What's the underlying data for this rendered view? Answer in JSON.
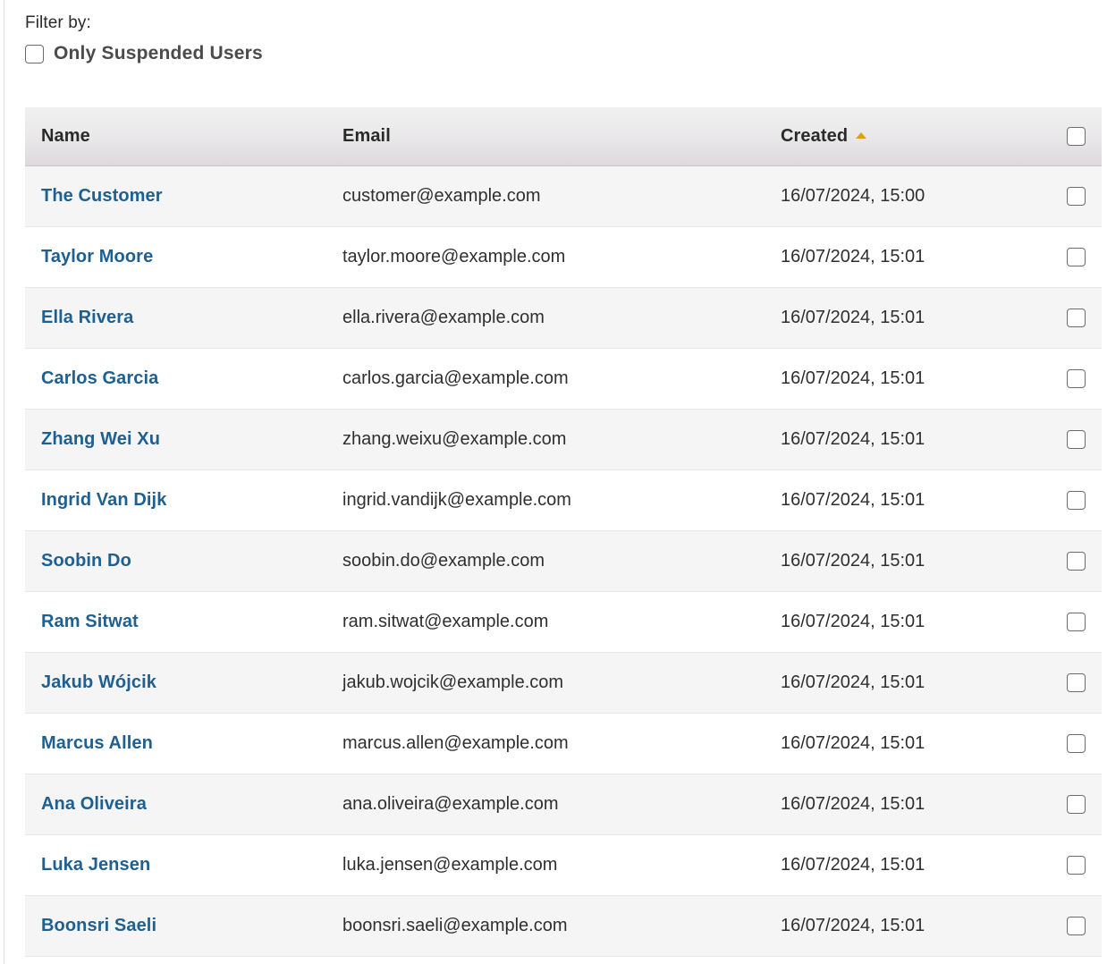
{
  "filter": {
    "label": "Filter by:",
    "suspended_checkbox_label": "Only Suspended Users",
    "suspended_checked": false
  },
  "table": {
    "columns": [
      {
        "key": "name",
        "label": "Name",
        "sorted": false
      },
      {
        "key": "email",
        "label": "Email",
        "sorted": false
      },
      {
        "key": "created",
        "label": "Created",
        "sorted": true,
        "sort_direction": "ascending",
        "sort_icon": "sort-ascending-triangle-icon"
      },
      {
        "key": "select",
        "label": "",
        "sorted": false
      }
    ],
    "select_all_checked": false,
    "link_color": "#1e6091",
    "sort_indicator_color": "#d9a407",
    "rows": [
      {
        "name": "The Customer",
        "email": "customer@example.com",
        "created": "16/07/2024, 15:00",
        "selected": false
      },
      {
        "name": "Taylor Moore",
        "email": "taylor.moore@example.com",
        "created": "16/07/2024, 15:01",
        "selected": false
      },
      {
        "name": "Ella Rivera",
        "email": "ella.rivera@example.com",
        "created": "16/07/2024, 15:01",
        "selected": false
      },
      {
        "name": "Carlos Garcia",
        "email": "carlos.garcia@example.com",
        "created": "16/07/2024, 15:01",
        "selected": false
      },
      {
        "name": "Zhang Wei Xu",
        "email": "zhang.weixu@example.com",
        "created": "16/07/2024, 15:01",
        "selected": false
      },
      {
        "name": "Ingrid Van Dijk",
        "email": "ingrid.vandijk@example.com",
        "created": "16/07/2024, 15:01",
        "selected": false
      },
      {
        "name": "Soobin Do",
        "email": "soobin.do@example.com",
        "created": "16/07/2024, 15:01",
        "selected": false
      },
      {
        "name": "Ram Sitwat",
        "email": "ram.sitwat@example.com",
        "created": "16/07/2024, 15:01",
        "selected": false
      },
      {
        "name": "Jakub Wójcik",
        "email": "jakub.wojcik@example.com",
        "created": "16/07/2024, 15:01",
        "selected": false
      },
      {
        "name": "Marcus Allen",
        "email": "marcus.allen@example.com",
        "created": "16/07/2024, 15:01",
        "selected": false
      },
      {
        "name": "Ana Oliveira",
        "email": "ana.oliveira@example.com",
        "created": "16/07/2024, 15:01",
        "selected": false
      },
      {
        "name": "Luka Jensen",
        "email": "luka.jensen@example.com",
        "created": "16/07/2024, 15:01",
        "selected": false
      },
      {
        "name": "Boonsri Saeli",
        "email": "boonsri.saeli@example.com",
        "created": "16/07/2024, 15:01",
        "selected": false
      }
    ]
  }
}
